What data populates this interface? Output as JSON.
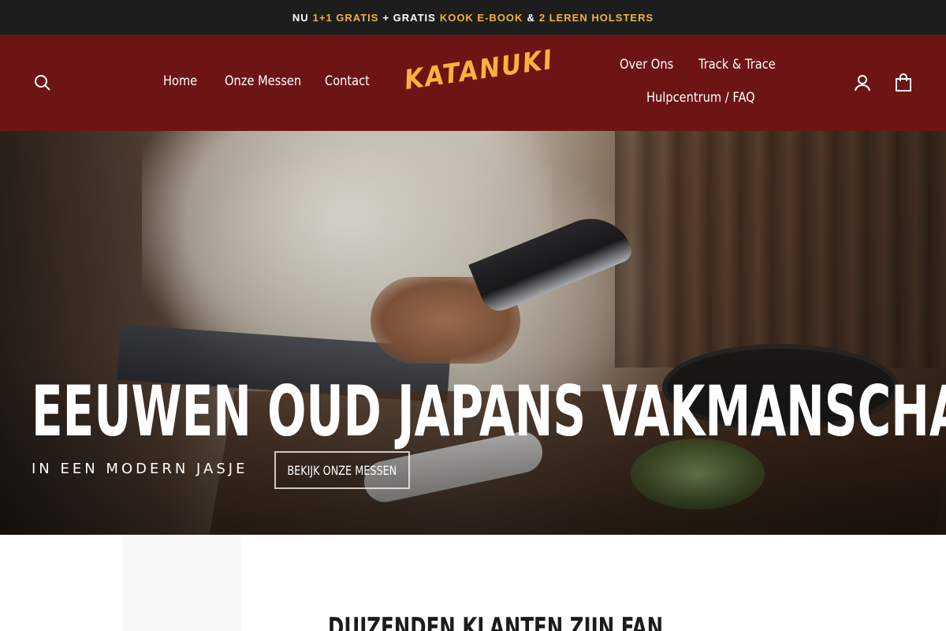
{
  "announcement": {
    "parts": [
      {
        "text": "NU",
        "accent": false
      },
      {
        "text": "1+1 GRATIS",
        "accent": true
      },
      {
        "text": "+ GRATIS",
        "accent": false
      },
      {
        "text": "KOOK E-BOOK",
        "accent": true
      },
      {
        "text": "&",
        "accent": false
      },
      {
        "text": "2 LEREN HOLSTERS",
        "accent": true
      }
    ],
    "accent_color": "#f2b23e"
  },
  "header": {
    "background_color": "#6d1414",
    "logo_text": "KATANUKI",
    "logo_color": "#f5b53c",
    "nav_left": [
      "Home",
      "Onze Messen",
      "Contact"
    ],
    "nav_right": [
      "Over Ons",
      "Track & Trace",
      "Hulpcentrum / FAQ"
    ],
    "icons": {
      "search": "search-icon",
      "account": "account-icon",
      "cart": "cart-icon"
    }
  },
  "hero": {
    "title": "EEUWEN OUD JAPANS VAKMANSCHAP",
    "subtitle": "IN EEN MODERN JASJE",
    "button_label": "BEKIJK ONZE MESSEN"
  },
  "section": {
    "title": "DUIZENDEN KLANTEN ZIJN FAN"
  }
}
